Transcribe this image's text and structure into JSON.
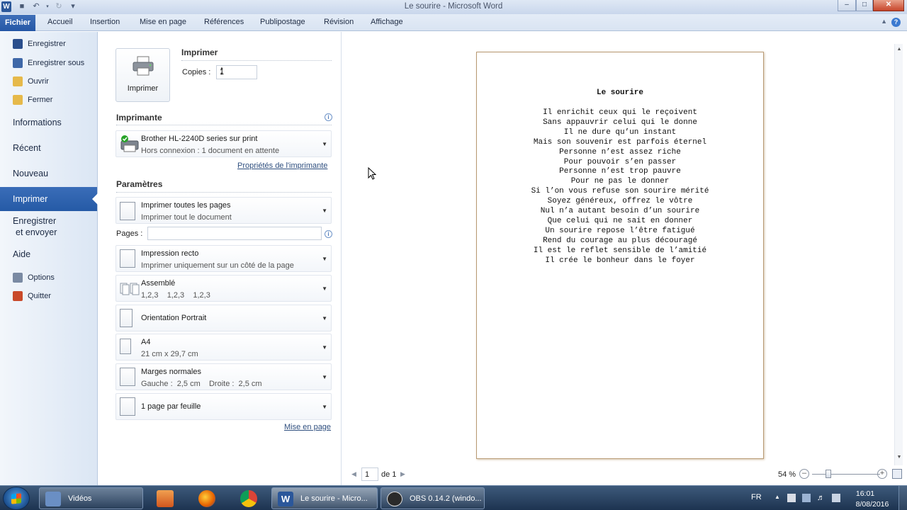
{
  "window": {
    "title": "Le sourire - Microsoft Word",
    "app_icon": "W"
  },
  "quick_access": {
    "save_icon": "save-icon",
    "undo_icon": "undo-icon",
    "redo_icon": "redo-icon",
    "customize_icon": "customize-icon"
  },
  "ribbon": {
    "file_tab": "Fichier",
    "tabs": [
      "Accueil",
      "Insertion",
      "Mise en page",
      "Références",
      "Publipostage",
      "Révision",
      "Affichage"
    ],
    "help_glyph": "?"
  },
  "backstage": {
    "top_items": [
      {
        "label": "Enregistrer",
        "icon": "save-icon",
        "color": "#2a4e8c"
      },
      {
        "label": "Enregistrer sous",
        "icon": "save-as-icon",
        "color": "#3f68a8"
      },
      {
        "label": "Ouvrir",
        "icon": "folder-open-icon",
        "color": "#e6b94a"
      },
      {
        "label": "Fermer",
        "icon": "folder-close-icon",
        "color": "#e6b94a"
      }
    ],
    "big_items": [
      "Informations",
      "Récent",
      "Nouveau"
    ],
    "selected_item": "Imprimer",
    "send_item": [
      "Enregistrer",
      "et envoyer"
    ],
    "help_item": "Aide",
    "bottom_items": [
      {
        "label": "Options",
        "icon": "options-icon",
        "color": "#7a8aa3"
      },
      {
        "label": "Quitter",
        "icon": "exit-icon",
        "color": "#c94a2a"
      }
    ]
  },
  "print": {
    "header": "Imprimer",
    "button_label": "Imprimer",
    "copies_label": "Copies :",
    "copies_value": "1",
    "printer_section": "Imprimante",
    "printer_name": "Brother HL-2240D series sur print",
    "printer_status": "Hors connexion : 1 document en attente",
    "printer_properties_link": "Propriétés de l'imprimante",
    "settings_section": "Paramètres",
    "pages_label": "Pages :",
    "pages_value": "",
    "settings": [
      {
        "title": "Imprimer toutes les pages",
        "subtitle": "Imprimer tout le document",
        "icon": "pages-icon"
      },
      {
        "title": "Impression recto",
        "subtitle": "Imprimer uniquement sur un côté de la page",
        "icon": "one-sided-icon"
      },
      {
        "title": "Assemblé",
        "subtitle": "1,2,3    1,2,3    1,2,3",
        "icon": "collated-icon"
      },
      {
        "title": "Orientation Portrait",
        "subtitle": "",
        "icon": "portrait-icon"
      },
      {
        "title": "A4",
        "subtitle": "21 cm x 29,7 cm",
        "icon": "paper-size-icon"
      },
      {
        "title": "Marges normales",
        "subtitle": "Gauche :  2,5 cm    Droite :  2,5 cm",
        "icon": "margins-icon"
      },
      {
        "title": "1 page par feuille",
        "subtitle": "",
        "icon": "pages-per-sheet-icon"
      }
    ],
    "page_setup_link": "Mise en page"
  },
  "document": {
    "title": "Le sourire",
    "lines": [
      "Il enrichit ceux qui le reçoivent",
      "Sans appauvrir celui qui le donne",
      "Il ne dure qu’un instant",
      "Mais son souvenir est parfois éternel",
      "Personne n’est assez riche",
      "Pour pouvoir s’en passer",
      "Personne n’est trop pauvre",
      "Pour ne pas le donner",
      "Si l’on vous refuse son sourire mérité",
      "Soyez généreux, offrez le vôtre",
      "Nul n’a autant besoin d’un sourire",
      "Que celui qui ne sait en donner",
      "Un sourire repose l’être fatigué",
      "Rend du courage au plus découragé",
      "Il est le reflet sensible de l’amitié",
      "Il crée le bonheur dans le foyer"
    ]
  },
  "preview_nav": {
    "page_number": "1",
    "page_of": "de 1",
    "zoom": "54 %",
    "zoom_percent": 54
  },
  "taskbar": {
    "videos_label": "Vidéos",
    "word_label": "Le sourire - Micro...",
    "obs_label": "OBS 0.14.2 (windo...",
    "language": "FR",
    "time": "16:01",
    "date": "8/08/2016"
  }
}
